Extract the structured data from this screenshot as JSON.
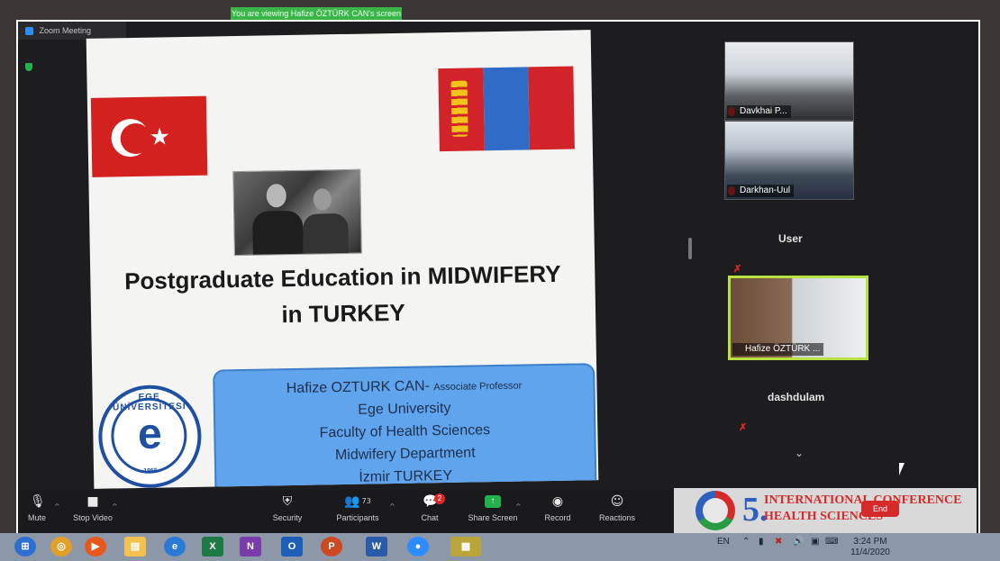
{
  "banner": {
    "text": "You are viewing Hafize ÖZTÜRK CAN's screen"
  },
  "window": {
    "title": "Zoom Meeting"
  },
  "slide": {
    "title_line1": "Postgraduate  Education in MIDWIFERY",
    "title_line2": "in TURKEY",
    "presenter": "Hafize OZTURK CAN-",
    "presenter_role": "Associate Professor",
    "university": "Ege University",
    "faculty": "Faculty of Health Sciences",
    "department": "Midwifery Department",
    "location": "İzmir TURKEY",
    "logo_ring": "EGE ÜNİVERSİTESİ",
    "logo_letter": "e",
    "logo_year": "1955"
  },
  "participants": [
    {
      "name": "Davkhai P..."
    },
    {
      "name": "Darkhan-Uul"
    },
    {
      "name": "User"
    },
    {
      "name": "Hafize ÖZTÜRK ..."
    },
    {
      "name": "dashdulam"
    }
  ],
  "toolbar": {
    "mute": "Mute",
    "stop_video": "Stop Video",
    "security": "Security",
    "participants": "Participants",
    "participants_count": "73",
    "chat": "Chat",
    "chat_badge": "2",
    "share_screen": "Share Screen",
    "record": "Record",
    "reactions": "Reactions",
    "end": "End"
  },
  "conference_logo": {
    "number": "5.",
    "line1": "INTERNATIONAL CONFERENCE",
    "line2": "HEALTH SCIENCES"
  },
  "taskbar": {
    "language": "EN",
    "time": "3:24 PM",
    "date": "11/4/2020"
  },
  "colors": {
    "zoom_green": "#22b14c",
    "speaker_highlight": "#b7e23f",
    "slide_box": "#5fa4ec",
    "mute_red": "#e02828"
  }
}
